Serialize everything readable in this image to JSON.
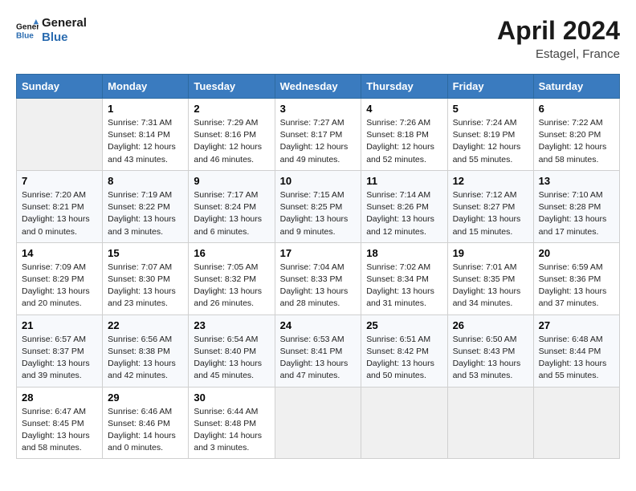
{
  "header": {
    "logo_line1": "General",
    "logo_line2": "Blue",
    "title": "April 2024",
    "subtitle": "Estagel, France"
  },
  "days_of_week": [
    "Sunday",
    "Monday",
    "Tuesday",
    "Wednesday",
    "Thursday",
    "Friday",
    "Saturday"
  ],
  "weeks": [
    [
      {
        "day": null
      },
      {
        "day": "1",
        "sunrise": "7:31 AM",
        "sunset": "8:14 PM",
        "daylight": "12 hours and 43 minutes."
      },
      {
        "day": "2",
        "sunrise": "7:29 AM",
        "sunset": "8:16 PM",
        "daylight": "12 hours and 46 minutes."
      },
      {
        "day": "3",
        "sunrise": "7:27 AM",
        "sunset": "8:17 PM",
        "daylight": "12 hours and 49 minutes."
      },
      {
        "day": "4",
        "sunrise": "7:26 AM",
        "sunset": "8:18 PM",
        "daylight": "12 hours and 52 minutes."
      },
      {
        "day": "5",
        "sunrise": "7:24 AM",
        "sunset": "8:19 PM",
        "daylight": "12 hours and 55 minutes."
      },
      {
        "day": "6",
        "sunrise": "7:22 AM",
        "sunset": "8:20 PM",
        "daylight": "12 hours and 58 minutes."
      }
    ],
    [
      {
        "day": "7",
        "sunrise": "7:20 AM",
        "sunset": "8:21 PM",
        "daylight": "13 hours and 0 minutes."
      },
      {
        "day": "8",
        "sunrise": "7:19 AM",
        "sunset": "8:22 PM",
        "daylight": "13 hours and 3 minutes."
      },
      {
        "day": "9",
        "sunrise": "7:17 AM",
        "sunset": "8:24 PM",
        "daylight": "13 hours and 6 minutes."
      },
      {
        "day": "10",
        "sunrise": "7:15 AM",
        "sunset": "8:25 PM",
        "daylight": "13 hours and 9 minutes."
      },
      {
        "day": "11",
        "sunrise": "7:14 AM",
        "sunset": "8:26 PM",
        "daylight": "13 hours and 12 minutes."
      },
      {
        "day": "12",
        "sunrise": "7:12 AM",
        "sunset": "8:27 PM",
        "daylight": "13 hours and 15 minutes."
      },
      {
        "day": "13",
        "sunrise": "7:10 AM",
        "sunset": "8:28 PM",
        "daylight": "13 hours and 17 minutes."
      }
    ],
    [
      {
        "day": "14",
        "sunrise": "7:09 AM",
        "sunset": "8:29 PM",
        "daylight": "13 hours and 20 minutes."
      },
      {
        "day": "15",
        "sunrise": "7:07 AM",
        "sunset": "8:30 PM",
        "daylight": "13 hours and 23 minutes."
      },
      {
        "day": "16",
        "sunrise": "7:05 AM",
        "sunset": "8:32 PM",
        "daylight": "13 hours and 26 minutes."
      },
      {
        "day": "17",
        "sunrise": "7:04 AM",
        "sunset": "8:33 PM",
        "daylight": "13 hours and 28 minutes."
      },
      {
        "day": "18",
        "sunrise": "7:02 AM",
        "sunset": "8:34 PM",
        "daylight": "13 hours and 31 minutes."
      },
      {
        "day": "19",
        "sunrise": "7:01 AM",
        "sunset": "8:35 PM",
        "daylight": "13 hours and 34 minutes."
      },
      {
        "day": "20",
        "sunrise": "6:59 AM",
        "sunset": "8:36 PM",
        "daylight": "13 hours and 37 minutes."
      }
    ],
    [
      {
        "day": "21",
        "sunrise": "6:57 AM",
        "sunset": "8:37 PM",
        "daylight": "13 hours and 39 minutes."
      },
      {
        "day": "22",
        "sunrise": "6:56 AM",
        "sunset": "8:38 PM",
        "daylight": "13 hours and 42 minutes."
      },
      {
        "day": "23",
        "sunrise": "6:54 AM",
        "sunset": "8:40 PM",
        "daylight": "13 hours and 45 minutes."
      },
      {
        "day": "24",
        "sunrise": "6:53 AM",
        "sunset": "8:41 PM",
        "daylight": "13 hours and 47 minutes."
      },
      {
        "day": "25",
        "sunrise": "6:51 AM",
        "sunset": "8:42 PM",
        "daylight": "13 hours and 50 minutes."
      },
      {
        "day": "26",
        "sunrise": "6:50 AM",
        "sunset": "8:43 PM",
        "daylight": "13 hours and 53 minutes."
      },
      {
        "day": "27",
        "sunrise": "6:48 AM",
        "sunset": "8:44 PM",
        "daylight": "13 hours and 55 minutes."
      }
    ],
    [
      {
        "day": "28",
        "sunrise": "6:47 AM",
        "sunset": "8:45 PM",
        "daylight": "13 hours and 58 minutes."
      },
      {
        "day": "29",
        "sunrise": "6:46 AM",
        "sunset": "8:46 PM",
        "daylight": "14 hours and 0 minutes."
      },
      {
        "day": "30",
        "sunrise": "6:44 AM",
        "sunset": "8:48 PM",
        "daylight": "14 hours and 3 minutes."
      },
      {
        "day": null
      },
      {
        "day": null
      },
      {
        "day": null
      },
      {
        "day": null
      }
    ]
  ],
  "labels": {
    "sunrise": "Sunrise:",
    "sunset": "Sunset:",
    "daylight": "Daylight:"
  }
}
